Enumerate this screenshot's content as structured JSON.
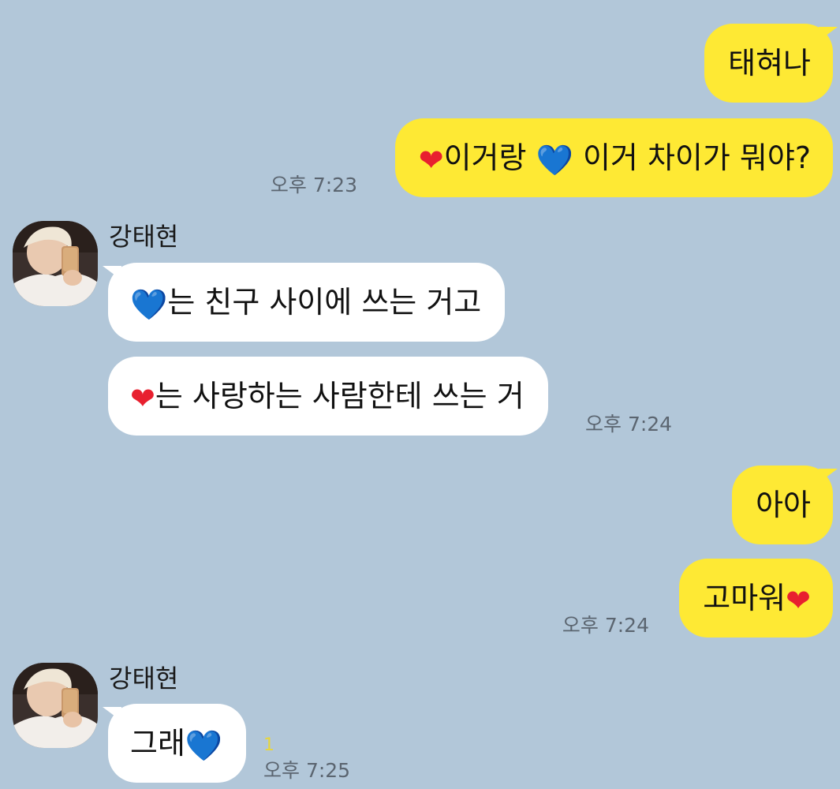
{
  "colors": {
    "background": "#b2c7d9",
    "my_bubble": "#fee934",
    "their_bubble": "#ffffff",
    "timestamp": "#5b6570",
    "unread": "#e8d63a",
    "heart_red": "#e8202f",
    "heart_blue": "#1e9cf0"
  },
  "emoji": {
    "red_heart": "❤",
    "blue_heart": "💙"
  },
  "messages": [
    {
      "from": "me",
      "text": "태혀나"
    },
    {
      "from": "me",
      "parts": [
        "❤",
        "이거랑 ",
        "💙",
        " 이거 차이가 뭐야?"
      ],
      "time": "오후 7:23"
    },
    {
      "from": "them",
      "sender": "강태현",
      "parts": [
        "💙",
        "는 친구 사이에 쓰는 거고"
      ]
    },
    {
      "from": "them",
      "parts": [
        "❤",
        "는 사랑하는 사람한테 쓰는 거"
      ],
      "time": "오후 7:24"
    },
    {
      "from": "me",
      "text": "아아"
    },
    {
      "from": "me",
      "parts": [
        "고마워",
        "❤"
      ],
      "time": "오후 7:24"
    },
    {
      "from": "them",
      "sender": "강태현",
      "parts": [
        "그래",
        "💙"
      ],
      "unread": "1",
      "time": "오후 7:25"
    }
  ]
}
